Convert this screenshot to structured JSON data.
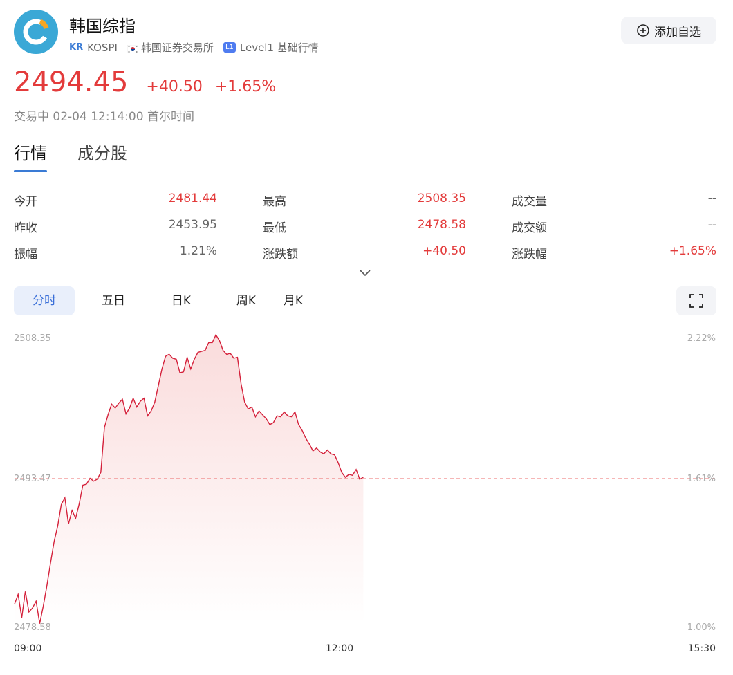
{
  "header": {
    "title": "韩国综指",
    "market_code": "KR",
    "symbol": "KOSPI",
    "exchange": "韩国证券交易所",
    "level_badge": "L1",
    "level_text": "Level1 基础行情",
    "add_watchlist_label": "添加自选"
  },
  "quote": {
    "price": "2494.45",
    "change": "+40.50",
    "change_pct": "+1.65%",
    "status": "交易中 02-04 12:14:00 首尔时间"
  },
  "tabs": [
    {
      "label": "行情",
      "active": true
    },
    {
      "label": "成分股",
      "active": false
    }
  ],
  "stats": [
    [
      {
        "label": "今开",
        "value": "2481.44",
        "red": true
      },
      {
        "label": "最高",
        "value": "2508.35",
        "red": true
      },
      {
        "label": "成交量",
        "value": "--",
        "red": false
      }
    ],
    [
      {
        "label": "昨收",
        "value": "2453.95",
        "red": false
      },
      {
        "label": "最低",
        "value": "2478.58",
        "red": true
      },
      {
        "label": "成交额",
        "value": "--",
        "red": false
      }
    ],
    [
      {
        "label": "振幅",
        "value": "1.21%",
        "red": false
      },
      {
        "label": "涨跌额",
        "value": "+40.50",
        "red": true
      },
      {
        "label": "涨跌幅",
        "value": "+1.65%",
        "red": true
      }
    ]
  ],
  "chart_tabs": [
    {
      "label": "分时",
      "active": true
    },
    {
      "label": "五日",
      "active": false
    },
    {
      "label": "日K",
      "active": false
    },
    {
      "label": "周K",
      "active": false
    },
    {
      "label": "月K",
      "active": false
    }
  ],
  "colors": {
    "up": "#e33b3b",
    "line": "#d4203a",
    "accent": "#3a7bd5",
    "ref_line": "#f08a8a"
  },
  "chart_data": {
    "type": "area",
    "y_left_labels": [
      "2508.35",
      "2493.47",
      "2478.58"
    ],
    "y_right_labels": [
      "2.22%",
      "1.61%",
      "1.00%"
    ],
    "x_labels": [
      "09:00",
      "12:00",
      "15:30"
    ],
    "ylim": [
      2478.58,
      2508.35
    ],
    "reference": 2493.47,
    "session": {
      "start_min": 0,
      "end_min": 390,
      "mid_min": 180
    },
    "series": [
      {
        "x": [
          0,
          2,
          4,
          6,
          8,
          10,
          12,
          14,
          16,
          18,
          20,
          22,
          24,
          26,
          28,
          30,
          32,
          34,
          36,
          38,
          40,
          42,
          44,
          46,
          48,
          50,
          52,
          54,
          56,
          58,
          60,
          62,
          64,
          66,
          68,
          70,
          72,
          74,
          76,
          78,
          80,
          82,
          84,
          86,
          88,
          90,
          92,
          94,
          96,
          98,
          100,
          102,
          104,
          106,
          108,
          110,
          112,
          114,
          116,
          118,
          120,
          122,
          124,
          126,
          128,
          130,
          132,
          134,
          136,
          138,
          140,
          142,
          144,
          146,
          148,
          150,
          152,
          154,
          156,
          158,
          160,
          162,
          164,
          166,
          168,
          170,
          172,
          174,
          176,
          178,
          180,
          182,
          184,
          186,
          188,
          190,
          192,
          194
        ],
        "y": [
          2480.6,
          2481.6,
          2479.2,
          2481.9,
          2479.8,
          2480.2,
          2480.9,
          2478.6,
          2480.4,
          2482.5,
          2484.8,
          2487.0,
          2488.6,
          2490.8,
          2491.5,
          2488.8,
          2490.2,
          2489.4,
          2490.9,
          2492.8,
          2492.9,
          2493.5,
          2493.2,
          2493.4,
          2494.1,
          2498.7,
          2500.0,
          2501.1,
          2500.7,
          2501.2,
          2501.6,
          2500.1,
          2500.7,
          2501.7,
          2500.8,
          2501.4,
          2501.7,
          2499.9,
          2500.4,
          2501.3,
          2503.0,
          2504.7,
          2506.0,
          2506.2,
          2505.8,
          2505.7,
          2504.3,
          2504.4,
          2505.9,
          2504.7,
          2505.7,
          2506.4,
          2506.5,
          2506.6,
          2507.4,
          2507.4,
          2508.2,
          2507.6,
          2506.6,
          2506.2,
          2506.3,
          2505.8,
          2505.9,
          2503.2,
          2501.3,
          2500.6,
          2500.8,
          2499.8,
          2500.4,
          2500.0,
          2499.6,
          2499.0,
          2499.2,
          2499.9,
          2499.8,
          2500.3,
          2499.9,
          2499.8,
          2500.3,
          2499.0,
          2498.4,
          2497.6,
          2497.0,
          2496.3,
          2496.6,
          2496.2,
          2496.0,
          2496.4,
          2496.0,
          2495.9,
          2495.1,
          2494.1,
          2493.6,
          2493.9,
          2493.8,
          2494.4,
          2493.4,
          2493.6
        ]
      }
    ]
  }
}
